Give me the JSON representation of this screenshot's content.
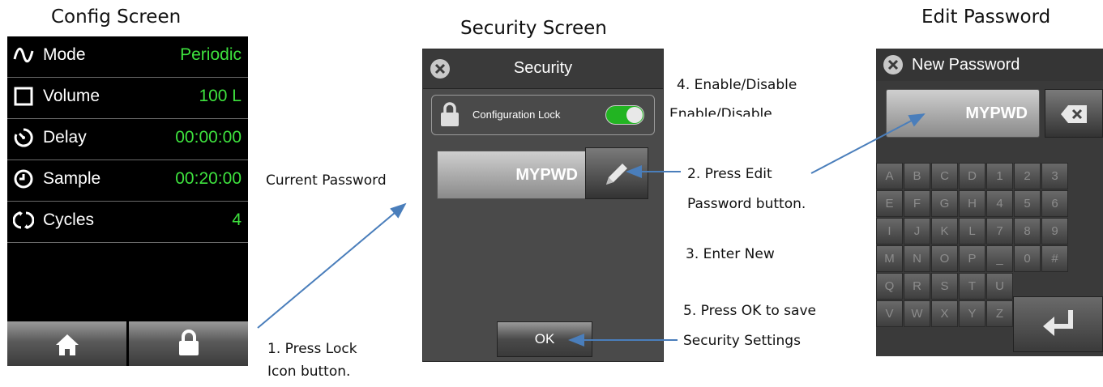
{
  "headings": {
    "config": "Config Screen",
    "security": "Security Screen",
    "edit_password": "Edit Password"
  },
  "config_screen": {
    "rows": [
      {
        "icon": "wave-icon",
        "label": "Mode",
        "value": "Periodic"
      },
      {
        "icon": "square-icon",
        "label": "Volume",
        "value": "100 L"
      },
      {
        "icon": "timer-icon",
        "label": "Delay",
        "value": "00:00:00"
      },
      {
        "icon": "clock-icon",
        "label": "Sample",
        "value": "00:20:00"
      },
      {
        "icon": "cycle-icon",
        "label": "Cycles",
        "value": "4"
      }
    ],
    "bottom_buttons": [
      "home-icon",
      "lock-icon"
    ],
    "value_color": "#3ee23e"
  },
  "security_screen": {
    "title": "Security",
    "lock_label": "Configuration Lock",
    "lock_enabled": true,
    "password": "MYPWD",
    "ok_label": "OK",
    "toggle_color": "#22b422"
  },
  "edit_password_screen": {
    "title": "New Password",
    "password": "MYPWD",
    "keys": [
      [
        "A",
        "B",
        "C",
        "D",
        "1",
        "2",
        "3"
      ],
      [
        "E",
        "F",
        "G",
        "H",
        "4",
        "5",
        "6"
      ],
      [
        "I",
        "J",
        "K",
        "L",
        "7",
        "8",
        "9"
      ],
      [
        "M",
        "N",
        "O",
        "P",
        "_",
        "0",
        "#"
      ],
      [
        "Q",
        "R",
        "S",
        "T",
        "U"
      ],
      [
        "V",
        "W",
        "X",
        "Y",
        "Z"
      ]
    ]
  },
  "annotations": {
    "current_password": "Current Password",
    "step1_line1": "1. Press Lock",
    "step1_line2": "Icon button.",
    "step2_line1": "2. Press Edit",
    "step2_line2": "Password button.",
    "step3": "3. Enter New",
    "step4": "4.  Enable/Disable",
    "step4_overlap": "Enable/Disable",
    "step5_line1": "5. Press OK to save",
    "step5_line2": "Security Settings"
  },
  "arrow_color": "#4a7ebb"
}
